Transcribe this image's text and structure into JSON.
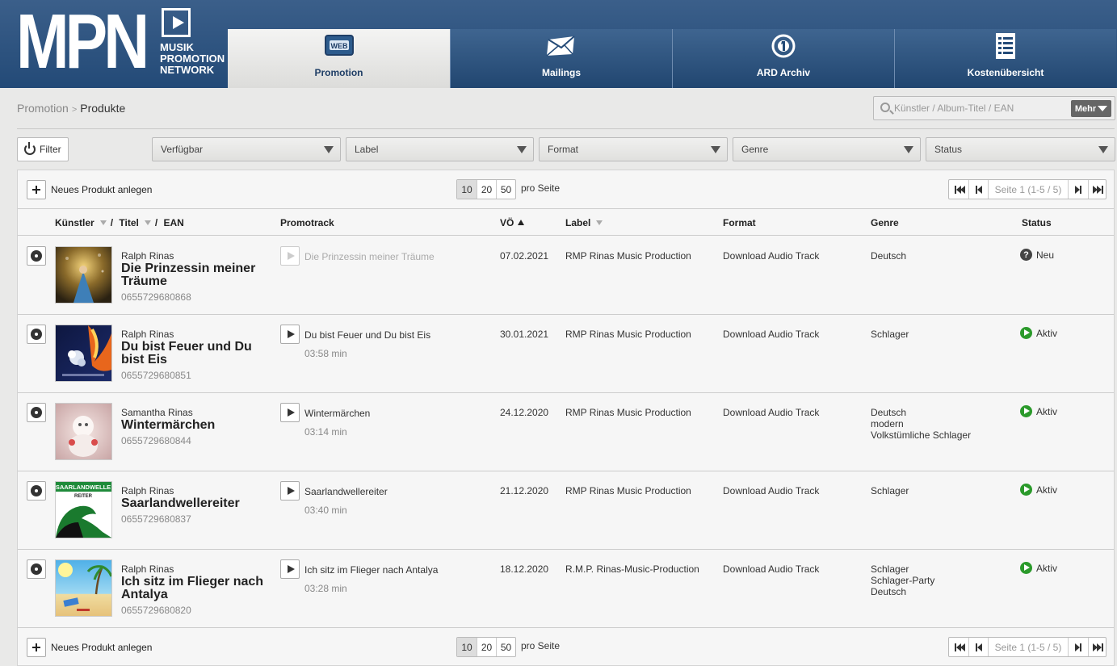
{
  "logo": {
    "big": "MPN",
    "line1": "MUSIK",
    "line2": "PROMOTION",
    "line3": "NETWORK"
  },
  "nav": {
    "tabs": [
      {
        "label": "Promotion",
        "icon": "web-icon",
        "active": true
      },
      {
        "label": "Mailings",
        "icon": "envelope-icon"
      },
      {
        "label": "ARD Archiv",
        "icon": "ard-logo-icon"
      },
      {
        "label": "Kostenübersicht",
        "icon": "document-list-icon"
      }
    ],
    "web_badge": "WEB"
  },
  "breadcrumb": {
    "parent": "Promotion",
    "separator": ">",
    "current": "Produkte"
  },
  "search": {
    "placeholder": "Künstler / Album-Titel / EAN",
    "more_label": "Mehr"
  },
  "filters": {
    "button_label": "Filter",
    "dropdowns": [
      "Verfügbar",
      "Label",
      "Format",
      "Genre",
      "Status"
    ]
  },
  "toolbar": {
    "new_product": "Neues Produkt anlegen",
    "page_sizes": [
      "10",
      "20",
      "50"
    ],
    "per_page": "pro Seite",
    "page_info": "Seite 1 (1-5 / 5)"
  },
  "table": {
    "headers": {
      "artist": "Künstler",
      "slash1": "/",
      "title": "Titel",
      "slash2": "/",
      "ean": "EAN",
      "promotrack": "Promotrack",
      "release": "VÖ",
      "label": "Label",
      "format": "Format",
      "genre": "Genre",
      "status": "Status"
    },
    "rows": [
      {
        "artist": "Ralph Rinas",
        "title": "Die Prinzessin meiner Träume",
        "ean": "0655729680868",
        "track": "Die Prinzessin meiner Träume",
        "duration": "",
        "release": "07.02.2021",
        "label": "RMP Rinas Music Production",
        "format": "Download Audio Track",
        "genre": [
          "Deutsch"
        ],
        "status": "Neu",
        "status_icon": "question-icon"
      },
      {
        "artist": "Ralph Rinas",
        "title": "Du bist Feuer und Du bist Eis",
        "ean": "0655729680851",
        "track": "Du bist Feuer und Du bist Eis",
        "duration": "03:58 min",
        "release": "30.01.2021",
        "label": "RMP Rinas Music Production",
        "format": "Download Audio Track",
        "genre": [
          "Schlager"
        ],
        "status": "Aktiv",
        "status_icon": "play-circle-icon"
      },
      {
        "artist": "Samantha Rinas",
        "title": "Wintermärchen",
        "ean": "0655729680844",
        "track": "Wintermärchen",
        "duration": "03:14 min",
        "release": "24.12.2020",
        "label": "RMP Rinas Music Production",
        "format": "Download Audio Track",
        "genre": [
          "Deutsch",
          "modern",
          "Volkstümliche Schlager"
        ],
        "status": "Aktiv",
        "status_icon": "play-circle-icon"
      },
      {
        "artist": "Ralph Rinas",
        "title": "Saarlandwellereiter",
        "ean": "0655729680837",
        "track": "Saarlandwellereiter",
        "duration": "03:40 min",
        "release": "21.12.2020",
        "label": "RMP Rinas Music Production",
        "format": "Download Audio Track",
        "genre": [
          "Schlager"
        ],
        "status": "Aktiv",
        "status_icon": "play-circle-icon"
      },
      {
        "artist": "Ralph Rinas",
        "title": "Ich sitz im Flieger nach Antalya",
        "ean": "0655729680820",
        "track": "Ich sitz im Flieger nach Antalya",
        "duration": "03:28 min",
        "release": "18.12.2020",
        "label": "R.M.P. Rinas-Music-Production",
        "format": "Download Audio Track",
        "genre": [
          "Schlager",
          "Schlager-Party",
          "Deutsch"
        ],
        "status": "Aktiv",
        "status_icon": "play-circle-icon"
      }
    ]
  },
  "cover_text": {
    "saarland_top": "SAARLANDWELLE",
    "saarland_sub": "REITER"
  },
  "colors": {
    "header": "#2b527f",
    "active_status": "#2b9a2b"
  }
}
